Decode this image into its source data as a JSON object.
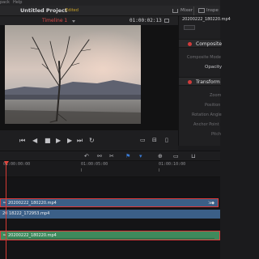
{
  "menubar": {
    "items": [
      "pack",
      "Help"
    ]
  },
  "titlebar": {
    "project_title": "Untitled Project",
    "edited": "Edited",
    "mixer_label": "Mixer",
    "inspector_label": "Inspe"
  },
  "viewer": {
    "timeline_name": "Timeline 1",
    "timecode": "01:00:02:13"
  },
  "inspector": {
    "file_title": "20200222_180220.mp4",
    "sections": {
      "composite": {
        "label": "Composite",
        "mode_label": "Composite Mode",
        "opacity_label": "Opacity"
      },
      "transform": {
        "label": "Transform",
        "zoom_label": "Zoom",
        "position_label": "Position",
        "rotation_label": "Rotation Angle",
        "anchor_label": "Anchor Point",
        "pitch_label": "Pitch"
      }
    }
  },
  "ruler": {
    "ticks": [
      "01:00:00:00",
      "01:00:05:00",
      "01:00:10:00"
    ]
  },
  "tracks": {
    "v2_clip": "20200222_180220.mp4",
    "v1_clip": "20 18222_172953.mp4",
    "a1_clip": "20200222_180220.mp4"
  },
  "colors": {
    "accent_red": "#d94a4a",
    "edited": "#c9a227",
    "clip_blue": "#3b5f87",
    "clip_green": "#3f8a5c",
    "selection": "#e03a3a"
  },
  "icons": {
    "transport": [
      "skip-start-icon",
      "step-back-icon",
      "play-reverse-icon",
      "stop-icon",
      "play-icon",
      "step-forward-icon",
      "skip-end-icon",
      "loop-icon"
    ],
    "timeline_tools": [
      "undo-icon",
      "link-icon",
      "flag-icon",
      "marker-icon",
      "zoom-icon",
      "magnet-icon"
    ]
  }
}
